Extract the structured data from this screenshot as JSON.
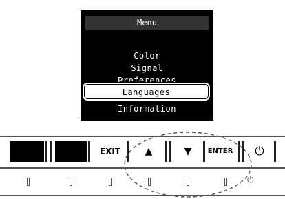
{
  "osd": {
    "title": "Menu",
    "items": [
      {
        "label": "Color"
      },
      {
        "label": "Signal"
      },
      {
        "label": "Preferences"
      },
      {
        "label": "Languages",
        "selected": true
      },
      {
        "label": "Information"
      }
    ]
  },
  "panel": {
    "buttons": [
      {
        "name": "blank-1",
        "label": ""
      },
      {
        "name": "blank-2",
        "label": ""
      },
      {
        "name": "exit",
        "label": "EXIT"
      },
      {
        "name": "up",
        "label": "▲"
      },
      {
        "name": "down",
        "label": "▼"
      },
      {
        "name": "enter",
        "label": "ENTER"
      },
      {
        "name": "power",
        "label": "⏻"
      }
    ],
    "power_led_symbol": "⏻"
  },
  "colors": {
    "osd_background": "#000000",
    "osd_title_bar": "#333333",
    "selection": "#ffffff"
  }
}
